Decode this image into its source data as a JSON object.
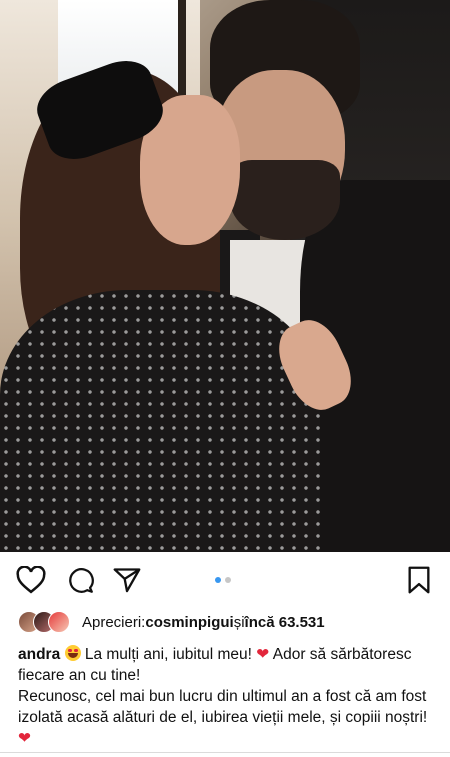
{
  "post": {
    "image_alt": "couple photo",
    "carousel": {
      "count": 2,
      "active": 1
    },
    "likes": {
      "prefix": "Aprecieri: ",
      "user": "cosminpigui",
      "middle": " și ",
      "others": "încă 63.531"
    },
    "caption": {
      "username": "andra",
      "line1_a": " La mulți ani, iubitul meu! ",
      "line1_b": " Ador să sărbătoresc fiecare an cu tine!",
      "line2": "Recunosc, cel mai bun lucru din ultimul an a fost că am fost izolată acasă alături de el, iubirea vieții mele, și copiii noștri! ",
      "heart_emoji": "❤"
    }
  },
  "colors": {
    "accent_blue": "#3897f0",
    "heart_red": "#e2263b"
  },
  "icons": [
    "heart-icon",
    "comment-icon",
    "share-icon",
    "bookmark-icon"
  ]
}
